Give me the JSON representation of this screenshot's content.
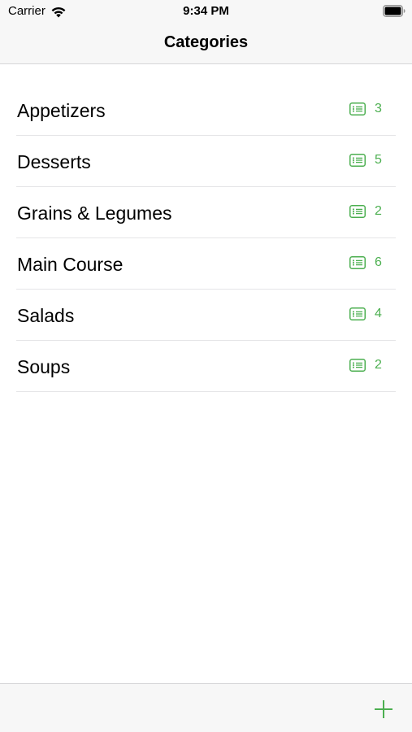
{
  "status_bar": {
    "carrier": "Carrier",
    "time": "9:34 PM",
    "wifi_icon": "wifi-icon",
    "battery_icon": "battery-icon"
  },
  "nav": {
    "title": "Categories"
  },
  "categories": [
    {
      "label": "Appetizers",
      "count": "3",
      "icon": "recipe-list-icon"
    },
    {
      "label": "Desserts",
      "count": "5",
      "icon": "recipe-list-icon"
    },
    {
      "label": "Grains & Legumes",
      "count": "2",
      "icon": "recipe-list-icon"
    },
    {
      "label": "Main Course",
      "count": "6",
      "icon": "recipe-list-icon"
    },
    {
      "label": "Salads",
      "count": "4",
      "icon": "recipe-list-icon"
    },
    {
      "label": "Soups",
      "count": "2",
      "icon": "recipe-list-icon"
    }
  ],
  "toolbar": {
    "add_icon": "plus-icon"
  },
  "colors": {
    "accent": "#4caf50",
    "bar_background": "#f7f7f7",
    "separator": "#e5e5e7"
  }
}
